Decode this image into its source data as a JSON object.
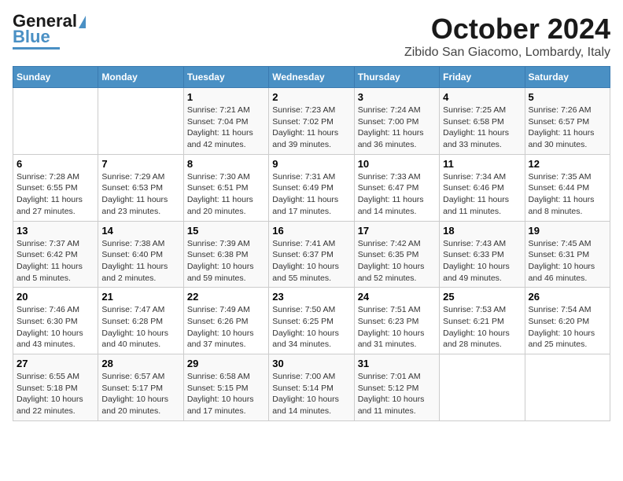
{
  "header": {
    "logo_line1": "General",
    "logo_line2": "Blue",
    "month": "October 2024",
    "location": "Zibido San Giacomo, Lombardy, Italy"
  },
  "weekdays": [
    "Sunday",
    "Monday",
    "Tuesday",
    "Wednesday",
    "Thursday",
    "Friday",
    "Saturday"
  ],
  "weeks": [
    [
      {
        "day": "",
        "info": ""
      },
      {
        "day": "",
        "info": ""
      },
      {
        "day": "1",
        "info": "Sunrise: 7:21 AM\nSunset: 7:04 PM\nDaylight: 11 hours and 42 minutes."
      },
      {
        "day": "2",
        "info": "Sunrise: 7:23 AM\nSunset: 7:02 PM\nDaylight: 11 hours and 39 minutes."
      },
      {
        "day": "3",
        "info": "Sunrise: 7:24 AM\nSunset: 7:00 PM\nDaylight: 11 hours and 36 minutes."
      },
      {
        "day": "4",
        "info": "Sunrise: 7:25 AM\nSunset: 6:58 PM\nDaylight: 11 hours and 33 minutes."
      },
      {
        "day": "5",
        "info": "Sunrise: 7:26 AM\nSunset: 6:57 PM\nDaylight: 11 hours and 30 minutes."
      }
    ],
    [
      {
        "day": "6",
        "info": "Sunrise: 7:28 AM\nSunset: 6:55 PM\nDaylight: 11 hours and 27 minutes."
      },
      {
        "day": "7",
        "info": "Sunrise: 7:29 AM\nSunset: 6:53 PM\nDaylight: 11 hours and 23 minutes."
      },
      {
        "day": "8",
        "info": "Sunrise: 7:30 AM\nSunset: 6:51 PM\nDaylight: 11 hours and 20 minutes."
      },
      {
        "day": "9",
        "info": "Sunrise: 7:31 AM\nSunset: 6:49 PM\nDaylight: 11 hours and 17 minutes."
      },
      {
        "day": "10",
        "info": "Sunrise: 7:33 AM\nSunset: 6:47 PM\nDaylight: 11 hours and 14 minutes."
      },
      {
        "day": "11",
        "info": "Sunrise: 7:34 AM\nSunset: 6:46 PM\nDaylight: 11 hours and 11 minutes."
      },
      {
        "day": "12",
        "info": "Sunrise: 7:35 AM\nSunset: 6:44 PM\nDaylight: 11 hours and 8 minutes."
      }
    ],
    [
      {
        "day": "13",
        "info": "Sunrise: 7:37 AM\nSunset: 6:42 PM\nDaylight: 11 hours and 5 minutes."
      },
      {
        "day": "14",
        "info": "Sunrise: 7:38 AM\nSunset: 6:40 PM\nDaylight: 11 hours and 2 minutes."
      },
      {
        "day": "15",
        "info": "Sunrise: 7:39 AM\nSunset: 6:38 PM\nDaylight: 10 hours and 59 minutes."
      },
      {
        "day": "16",
        "info": "Sunrise: 7:41 AM\nSunset: 6:37 PM\nDaylight: 10 hours and 55 minutes."
      },
      {
        "day": "17",
        "info": "Sunrise: 7:42 AM\nSunset: 6:35 PM\nDaylight: 10 hours and 52 minutes."
      },
      {
        "day": "18",
        "info": "Sunrise: 7:43 AM\nSunset: 6:33 PM\nDaylight: 10 hours and 49 minutes."
      },
      {
        "day": "19",
        "info": "Sunrise: 7:45 AM\nSunset: 6:31 PM\nDaylight: 10 hours and 46 minutes."
      }
    ],
    [
      {
        "day": "20",
        "info": "Sunrise: 7:46 AM\nSunset: 6:30 PM\nDaylight: 10 hours and 43 minutes."
      },
      {
        "day": "21",
        "info": "Sunrise: 7:47 AM\nSunset: 6:28 PM\nDaylight: 10 hours and 40 minutes."
      },
      {
        "day": "22",
        "info": "Sunrise: 7:49 AM\nSunset: 6:26 PM\nDaylight: 10 hours and 37 minutes."
      },
      {
        "day": "23",
        "info": "Sunrise: 7:50 AM\nSunset: 6:25 PM\nDaylight: 10 hours and 34 minutes."
      },
      {
        "day": "24",
        "info": "Sunrise: 7:51 AM\nSunset: 6:23 PM\nDaylight: 10 hours and 31 minutes."
      },
      {
        "day": "25",
        "info": "Sunrise: 7:53 AM\nSunset: 6:21 PM\nDaylight: 10 hours and 28 minutes."
      },
      {
        "day": "26",
        "info": "Sunrise: 7:54 AM\nSunset: 6:20 PM\nDaylight: 10 hours and 25 minutes."
      }
    ],
    [
      {
        "day": "27",
        "info": "Sunrise: 6:55 AM\nSunset: 5:18 PM\nDaylight: 10 hours and 22 minutes."
      },
      {
        "day": "28",
        "info": "Sunrise: 6:57 AM\nSunset: 5:17 PM\nDaylight: 10 hours and 20 minutes."
      },
      {
        "day": "29",
        "info": "Sunrise: 6:58 AM\nSunset: 5:15 PM\nDaylight: 10 hours and 17 minutes."
      },
      {
        "day": "30",
        "info": "Sunrise: 7:00 AM\nSunset: 5:14 PM\nDaylight: 10 hours and 14 minutes."
      },
      {
        "day": "31",
        "info": "Sunrise: 7:01 AM\nSunset: 5:12 PM\nDaylight: 10 hours and 11 minutes."
      },
      {
        "day": "",
        "info": ""
      },
      {
        "day": "",
        "info": ""
      }
    ]
  ]
}
